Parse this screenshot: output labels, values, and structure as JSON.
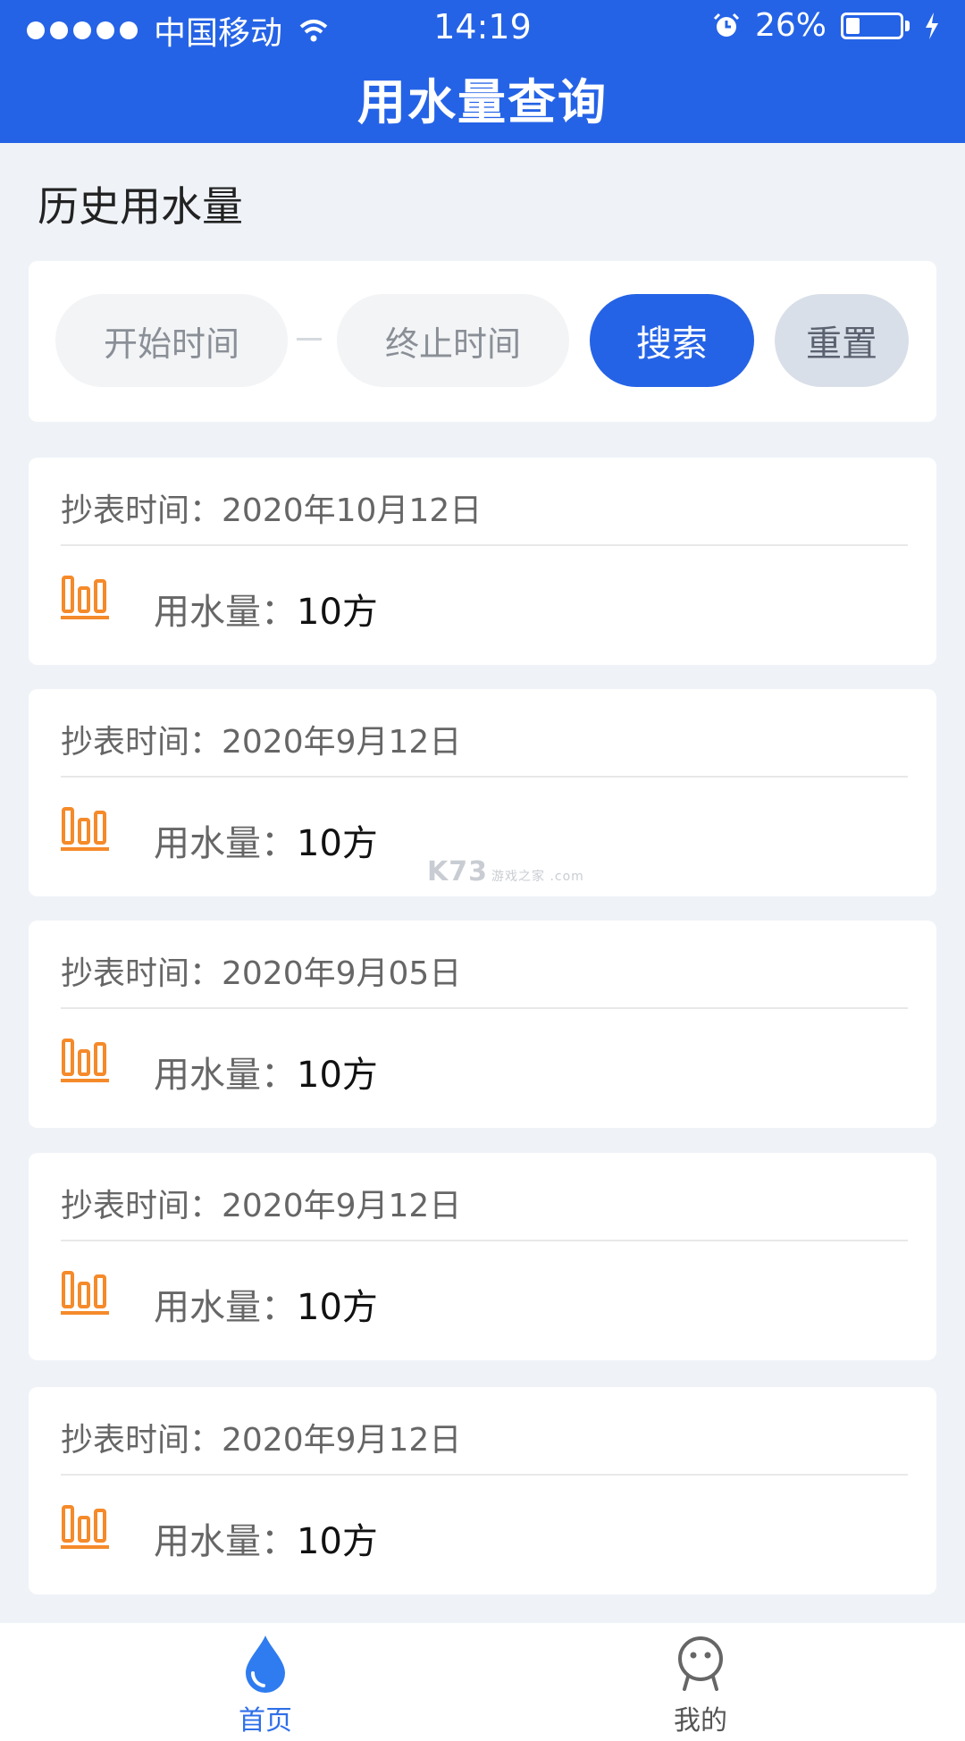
{
  "status_bar": {
    "carrier": "中国移动",
    "time": "14:19",
    "battery": "26%",
    "battery_level": 0.26,
    "icons": [
      "signal-dots-icon",
      "wifi-icon",
      "alarm-icon",
      "battery-icon",
      "charging-icon"
    ]
  },
  "header": {
    "title": "用水量查询"
  },
  "section": {
    "title": "历史用水量"
  },
  "search": {
    "start_placeholder": "开始时间",
    "end_placeholder": "终止时间",
    "search_label": "搜索",
    "reset_label": "重置"
  },
  "records": [
    {
      "date": "抄表时间：2020年10月12日",
      "usage_label": "用水量：",
      "usage_value": "10方"
    },
    {
      "date": "抄表时间：2020年9月12日",
      "usage_label": "用水量：",
      "usage_value": "10方"
    },
    {
      "date": "抄表时间：2020年9月05日",
      "usage_label": "用水量：",
      "usage_value": "10方"
    },
    {
      "date": "抄表时间：2020年9月12日",
      "usage_label": "用水量：",
      "usage_value": "10方"
    },
    {
      "date": "抄表时间：2020年9月12日",
      "usage_label": "用水量：",
      "usage_value": "10方"
    }
  ],
  "tabbar": {
    "home_label": "首页",
    "mine_label": "我的",
    "active": "首页"
  },
  "watermark": {
    "text": "K73",
    "sub": "游戏之家 .com"
  },
  "colors": {
    "primary": "#2563e6",
    "accent_orange": "#f58a2a",
    "background": "#eff3f8"
  }
}
